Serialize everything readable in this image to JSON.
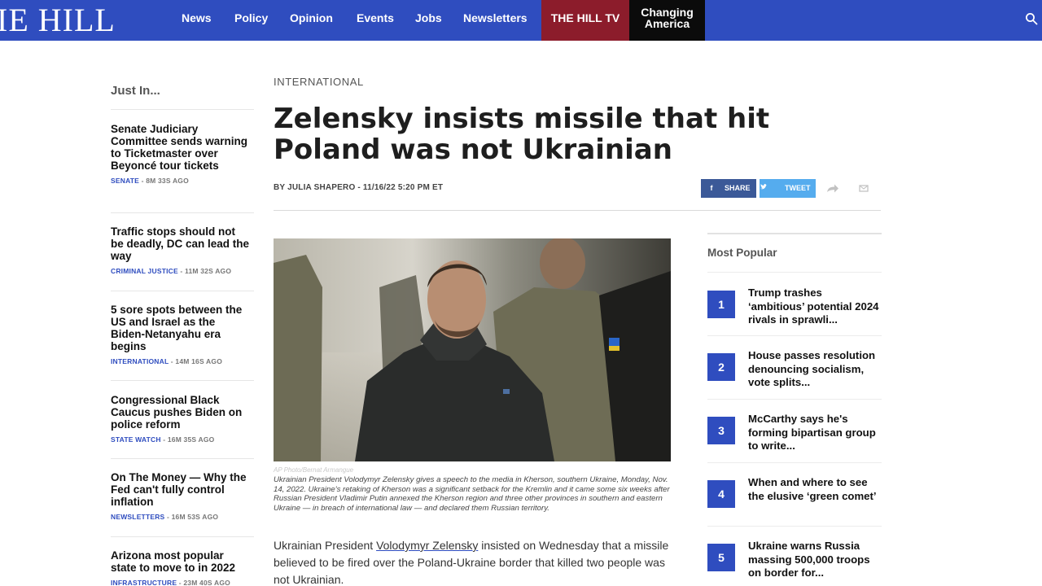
{
  "nav": {
    "logo_text": "IE HILL",
    "links": [
      "News",
      "Policy",
      "Opinion",
      "Events",
      "Jobs",
      "Newsletters"
    ],
    "hill_tv": "THE HILL TV",
    "changing_line1": "Changing",
    "changing_line2": "America",
    "search_icon": "search-icon"
  },
  "sidebar": {
    "heading": "Just In...",
    "items": [
      {
        "title": "Senate Judiciary Committee sends warning to Ticketmaster over Beyoncé tour tickets",
        "section": "SENATE",
        "time": "8M 33S AGO"
      },
      {
        "title": "Traffic stops should not be deadly, DC can lead the way",
        "section": "CRIMINAL JUSTICE",
        "time": "11M 32S AGO"
      },
      {
        "title": "5 sore spots between the US and Israel as the Biden-Netanyahu era begins",
        "section": "INTERNATIONAL",
        "time": "14M 16S AGO"
      },
      {
        "title": "Congressional Black Caucus pushes Biden on police reform",
        "section": "STATE WATCH",
        "time": "16M 35S AGO"
      },
      {
        "title": "On The Money — Why the Fed can't fully control inflation",
        "section": "NEWSLETTERS",
        "time": "16M 53S AGO"
      },
      {
        "title": "Arizona most popular state to move to in 2022",
        "section": "INFRASTRUCTURE",
        "time": "23M 40S AGO"
      }
    ]
  },
  "article": {
    "section": "INTERNATIONAL",
    "headline": "Zelensky insists missile that hit Poland was not Ukrainian",
    "byline": "BY JULIA SHAPERO - 11/16/22 5:20 PM ET",
    "share": {
      "facebook": "SHARE",
      "twitter": "TWEET"
    },
    "photo_credit": "AP Photo/Bernat Armangue",
    "caption": "Ukrainian President Volodymyr Zelensky gives a speech to the media in Kherson, southern Ukraine, Monday, Nov. 14, 2022. Ukraine's retaking of Kherson was a significant setback for the Kremlin and it came some six weeks after Russian President Vladimir Putin annexed the Kherson region and three other provinces in southern and eastern Ukraine — in breach of international law — and declared them Russian territory.",
    "body_prefix": "Ukrainian President ",
    "body_link": "Volodymyr Zelensky",
    "body_suffix": " insisted on Wednesday that a missile believed to be fired over the Poland-Ukraine border that killed two people was not Ukrainian."
  },
  "most_popular": {
    "heading": "Most Popular",
    "items": [
      {
        "num": "1",
        "title": "Trump trashes ‘ambitious’ potential 2024 rivals in sprawli..."
      },
      {
        "num": "2",
        "title": "House passes resolution denouncing socialism, vote splits..."
      },
      {
        "num": "3",
        "title": "McCarthy says he's forming bipartisan group to write..."
      },
      {
        "num": "4",
        "title": "When and where to see the elusive ‘green comet’"
      },
      {
        "num": "5",
        "title": "Ukraine warns Russia massing 500,000 troops on border for..."
      }
    ]
  },
  "colors": {
    "brand_blue": "#2f4dbf",
    "hill_tv_red": "#8c1c2b",
    "facebook": "#3b5998",
    "twitter": "#55acee"
  }
}
